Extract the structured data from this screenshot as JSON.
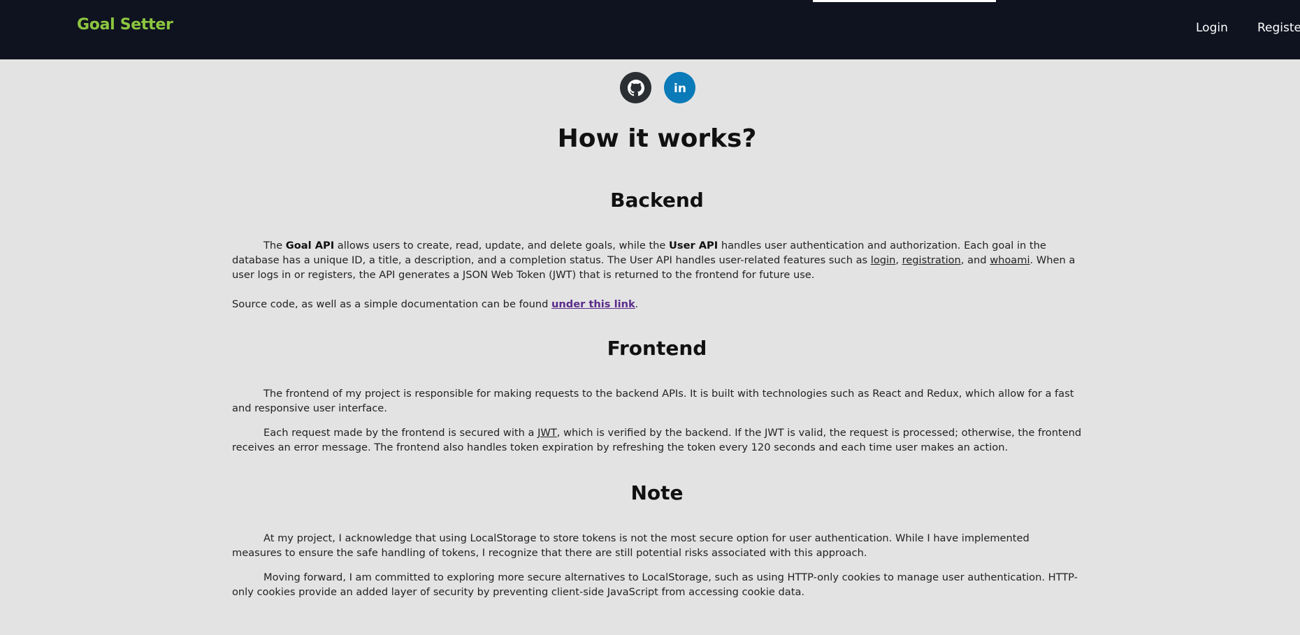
{
  "header": {
    "brand": "Goal Setter",
    "login_label": "Login",
    "register_label": "Registe"
  },
  "social": {
    "github_icon": "github-icon",
    "linkedin_icon": "linkedin-icon",
    "linkedin_text": "in"
  },
  "colors": {
    "nav_bg": "#0f1320",
    "brand": "#8dc63f",
    "page_bg": "#e3e3e3",
    "github_bg": "#2b2f33",
    "linkedin_bg": "#0a7ab8",
    "link": "#5b2c8b"
  },
  "content": {
    "title": "How it works?",
    "backend": {
      "heading": "Backend",
      "p1": {
        "t1": "The ",
        "goal_api": "Goal API",
        "t2": " allows users to create, read, update, and delete goals, while the ",
        "user_api": "User API",
        "t3": " handles user authentication and authorization. Each goal in the database has a unique ID, a title, a description, and a completion status. The User API handles user-related features such as ",
        "login": "login",
        "t4": ", ",
        "registration": "registration",
        "t5": ", and ",
        "whoami": "whoami",
        "t6": ". When a user logs in or registers, the API generates a JSON Web Token (JWT) that is returned to the frontend for future use."
      },
      "p2": {
        "t1": "Source code, as well as a simple documentation can be found ",
        "link": "under this link",
        "t2": "."
      }
    },
    "frontend": {
      "heading": "Frontend",
      "p1": "The frontend of my project is responsible for making requests to the backend APIs. It is built with technologies such as React and Redux, which allow for a fast and responsive user interface.",
      "p2": {
        "t1": "Each request made by the frontend is secured with a ",
        "jwt": "JWT",
        "t2": ", which is verified by the backend. If the JWT is valid, the request is processed; otherwise, the frontend receives an error message. The frontend also handles token expiration by refreshing the token every 120 seconds and each time user makes an action."
      }
    },
    "note": {
      "heading": "Note",
      "p1": "At my project, I acknowledge that using LocalStorage to store tokens is not the most secure option for user authentication. While I have implemented measures to ensure the safe handling of tokens, I recognize that there are still potential risks associated with this approach.",
      "p2": "Moving forward, I am committed to exploring more secure alternatives to LocalStorage, such as using HTTP-only cookies to manage user authentication. HTTP-only cookies provide an added layer of security by preventing client-side JavaScript from accessing cookie data."
    }
  }
}
